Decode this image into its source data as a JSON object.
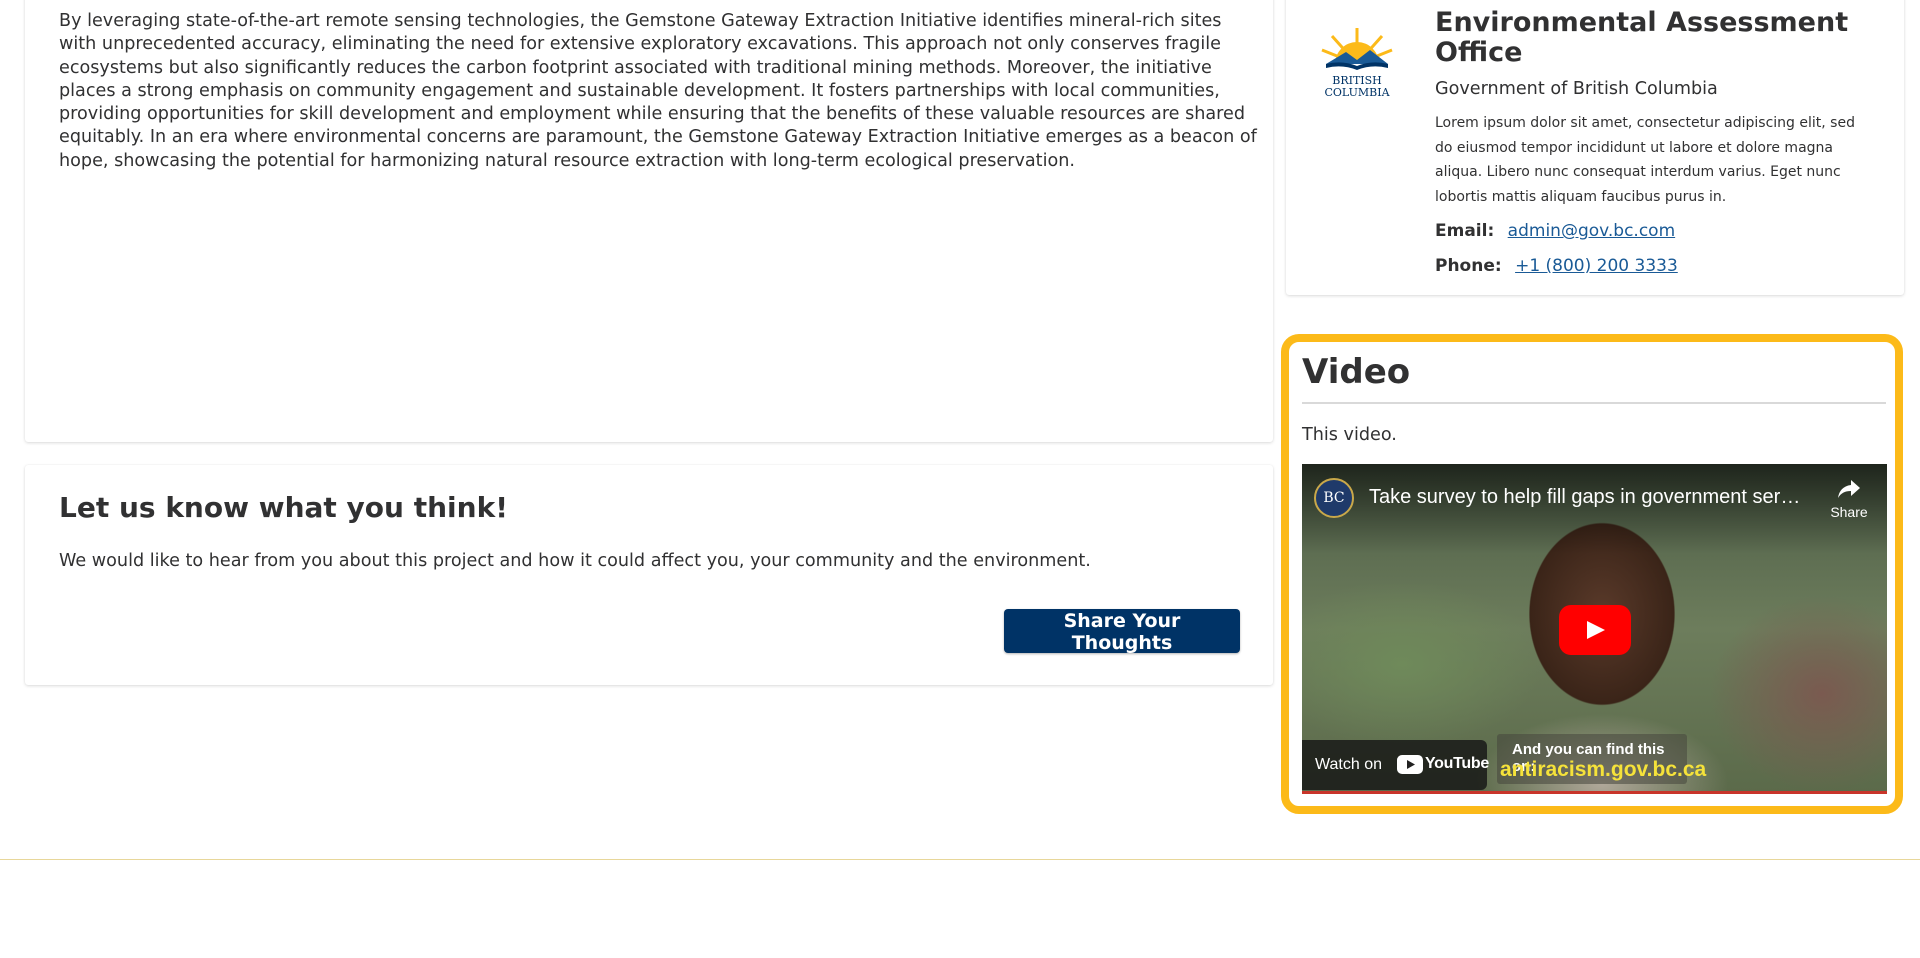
{
  "project": {
    "description": "By leveraging state-of-the-art remote sensing technologies, the Gemstone Gateway Extraction Initiative identifies mineral-rich sites with unprecedented accuracy, eliminating the need for extensive exploratory excavations. This approach not only conserves fragile ecosystems but also significantly reduces the carbon footprint associated with traditional mining methods. Moreover, the initiative places a strong emphasis on community engagement and sustainable development. It fosters partnerships with local communities, providing opportunities for skill development and employment while ensuring that the benefits of these valuable resources are shared equitably. In an era where environmental concerns are paramount, the Gemstone Gateway Extraction Initiative emerges as a beacon of hope, showcasing the potential for harmonizing natural resource extraction with long-term ecological preservation."
  },
  "feedback": {
    "heading": "Let us know what you think!",
    "text": "We would like to hear from you about this project and how it could affect you, your community and the environment.",
    "button_label": "Share Your Thoughts"
  },
  "contact": {
    "logo_text_line1": "BRITISH",
    "logo_text_line2": "COLUMBIA",
    "office_name": "Environmental Assessment Office",
    "office_sub": "Government of British Columbia",
    "office_desc": "Lorem ipsum dolor sit amet, consectetur adipiscing elit, sed do eiusmod tempor incididunt ut labore et dolore magna aliqua. Libero nunc consequat interdum varius. Eget nunc lobortis mattis aliquam faucibus purus in.",
    "email_label": "Email:",
    "email": "admin@gov.bc.com",
    "phone_label": "Phone:",
    "phone": "+1 (800) 200 3333"
  },
  "video": {
    "heading": "Video",
    "caption": "This video.",
    "channel_avatar_text": "BC",
    "title": "Take survey to help fill gaps in government services",
    "share_label": "Share",
    "watch_on_label": "Watch on",
    "youtube_word": "YouTube",
    "find_label": "And you can find this on:",
    "find_url": "antiracism.gov.bc.ca"
  },
  "colors": {
    "primary": "#003366",
    "highlight": "#fcba19",
    "link": "#1a5a96",
    "youtube_red": "#ff0000"
  }
}
